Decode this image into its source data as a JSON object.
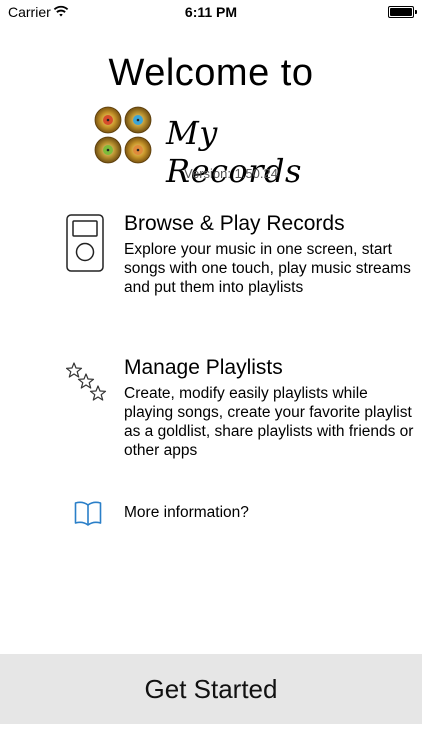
{
  "status_bar": {
    "carrier": "Carrier",
    "time": "6:11 PM"
  },
  "header": {
    "welcome": "Welcome to",
    "app_name": "My Records",
    "version": "Version: 1.50.24"
  },
  "features": [
    {
      "title": "Browse & Play Records",
      "description": "Explore your music in one screen, start songs with one touch, play music streams and put them into playlists"
    },
    {
      "title": "Manage Playlists",
      "description": "Create, modify easily playlists while playing songs, create your favorite playlist as a goldlist, share playlists with friends or other apps"
    }
  ],
  "more_info": "More information?",
  "get_started": "Get Started",
  "colors": {
    "accent": "#2a7fc8",
    "button_bg": "#e6e6e6"
  }
}
